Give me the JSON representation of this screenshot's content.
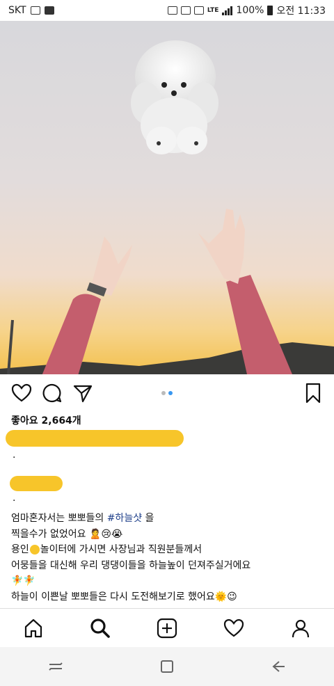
{
  "status_bar": {
    "carrier": "SKT",
    "network": "LTE",
    "battery": "100%",
    "time": "오전 11:33"
  },
  "post": {
    "likes": "좋아요 2,664개",
    "carousel": {
      "count": 2,
      "active_index": 1
    },
    "comment_dot": ".",
    "caption_dot": ".",
    "hashtag": "#하늘샷",
    "caption": {
      "line1_pre": "엄마혼자서는 뽀뽀들의 ",
      "line1_post": " 을",
      "line2": "찍을수가 없었어요 🙎😢😭",
      "line3_a": "용인",
      "line3_b": "놀이터에 가시면 사장님과 직원분들께서",
      "line4": "어뭉들을 대신해 우리 댕댕이들을 하늘높이 던져주실거에요",
      "line5": "🧚🧚",
      "line6": "하늘이 이쁜날 뽀뽀들은 다시 도전해보기로 했어요🌞😉"
    }
  },
  "icons": {
    "like": "heart-icon",
    "comment": "comment-icon",
    "share": "send-icon",
    "save": "bookmark-icon",
    "home": "home-icon",
    "search": "search-icon",
    "new_post": "add-post-icon",
    "activity": "heart-icon",
    "profile": "profile-icon",
    "recents": "recents-icon",
    "overview": "overview-icon",
    "back": "back-icon"
  },
  "colors": {
    "redaction": "#f7c52a",
    "hashtag": "#1e3f8a",
    "carousel_active": "#3897f0"
  }
}
